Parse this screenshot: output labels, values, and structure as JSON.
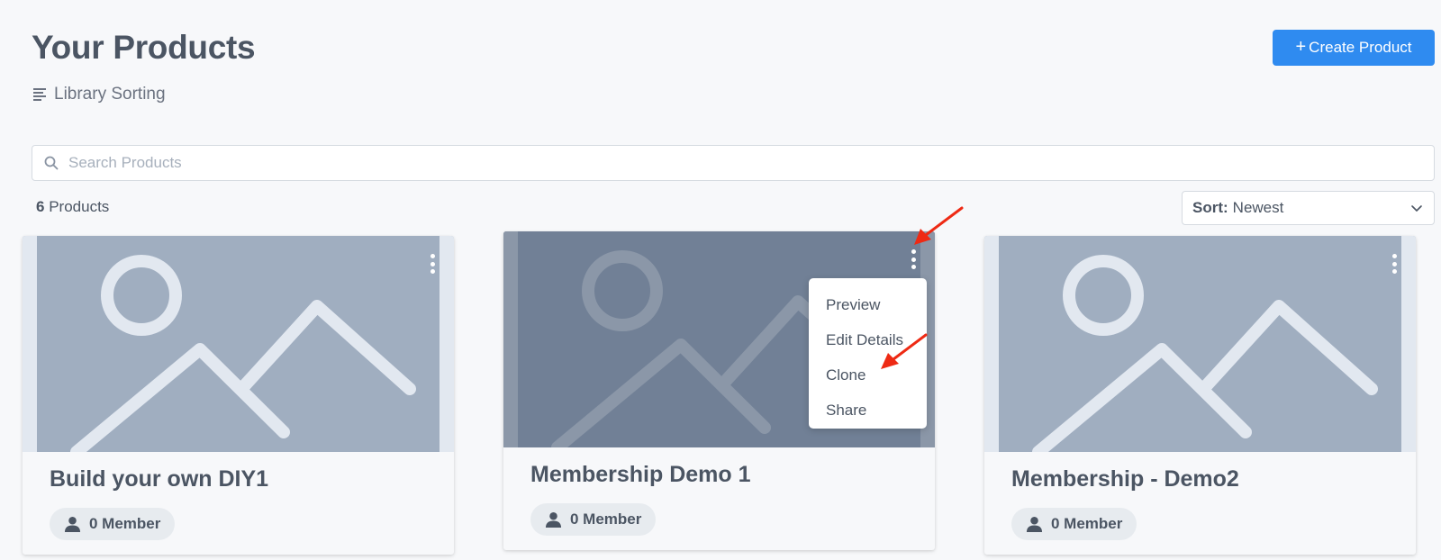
{
  "header": {
    "title": "Your Products",
    "library_sorting": "Library Sorting",
    "create_button": "Create Product",
    "create_button_icon": "+"
  },
  "search": {
    "placeholder": "Search Products",
    "value": ""
  },
  "summary": {
    "count": "6",
    "label": "Products"
  },
  "sort": {
    "label": "Sort:",
    "value": "Newest"
  },
  "products": [
    {
      "title": "Build your own DIY1",
      "members": "0 Member",
      "thumbnail_shade": "#a0aec0"
    },
    {
      "title": "Membership Demo 1",
      "members": "0 Member",
      "thumbnail_shade": "#718096",
      "dimmed": true
    },
    {
      "title": "Membership - Demo2",
      "members": "0 Member",
      "thumbnail_shade": "#a0aec0"
    }
  ],
  "context_menu": {
    "items": [
      "Preview",
      "Edit Details",
      "Clone",
      "Share"
    ]
  },
  "colors": {
    "accent": "#2f8bf0",
    "annotation_arrow": "#ee2a14",
    "thumbnail": "#a0aec0",
    "thumbnail_dimmed": "#718096"
  },
  "icons": {
    "library_sorting": "lines-icon",
    "search": "search-icon",
    "sort_dropdown": "chevron-down-icon",
    "card_menu": "kebab-menu-icon",
    "member": "user-icon",
    "thumbnail": "image-placeholder-icon"
  }
}
